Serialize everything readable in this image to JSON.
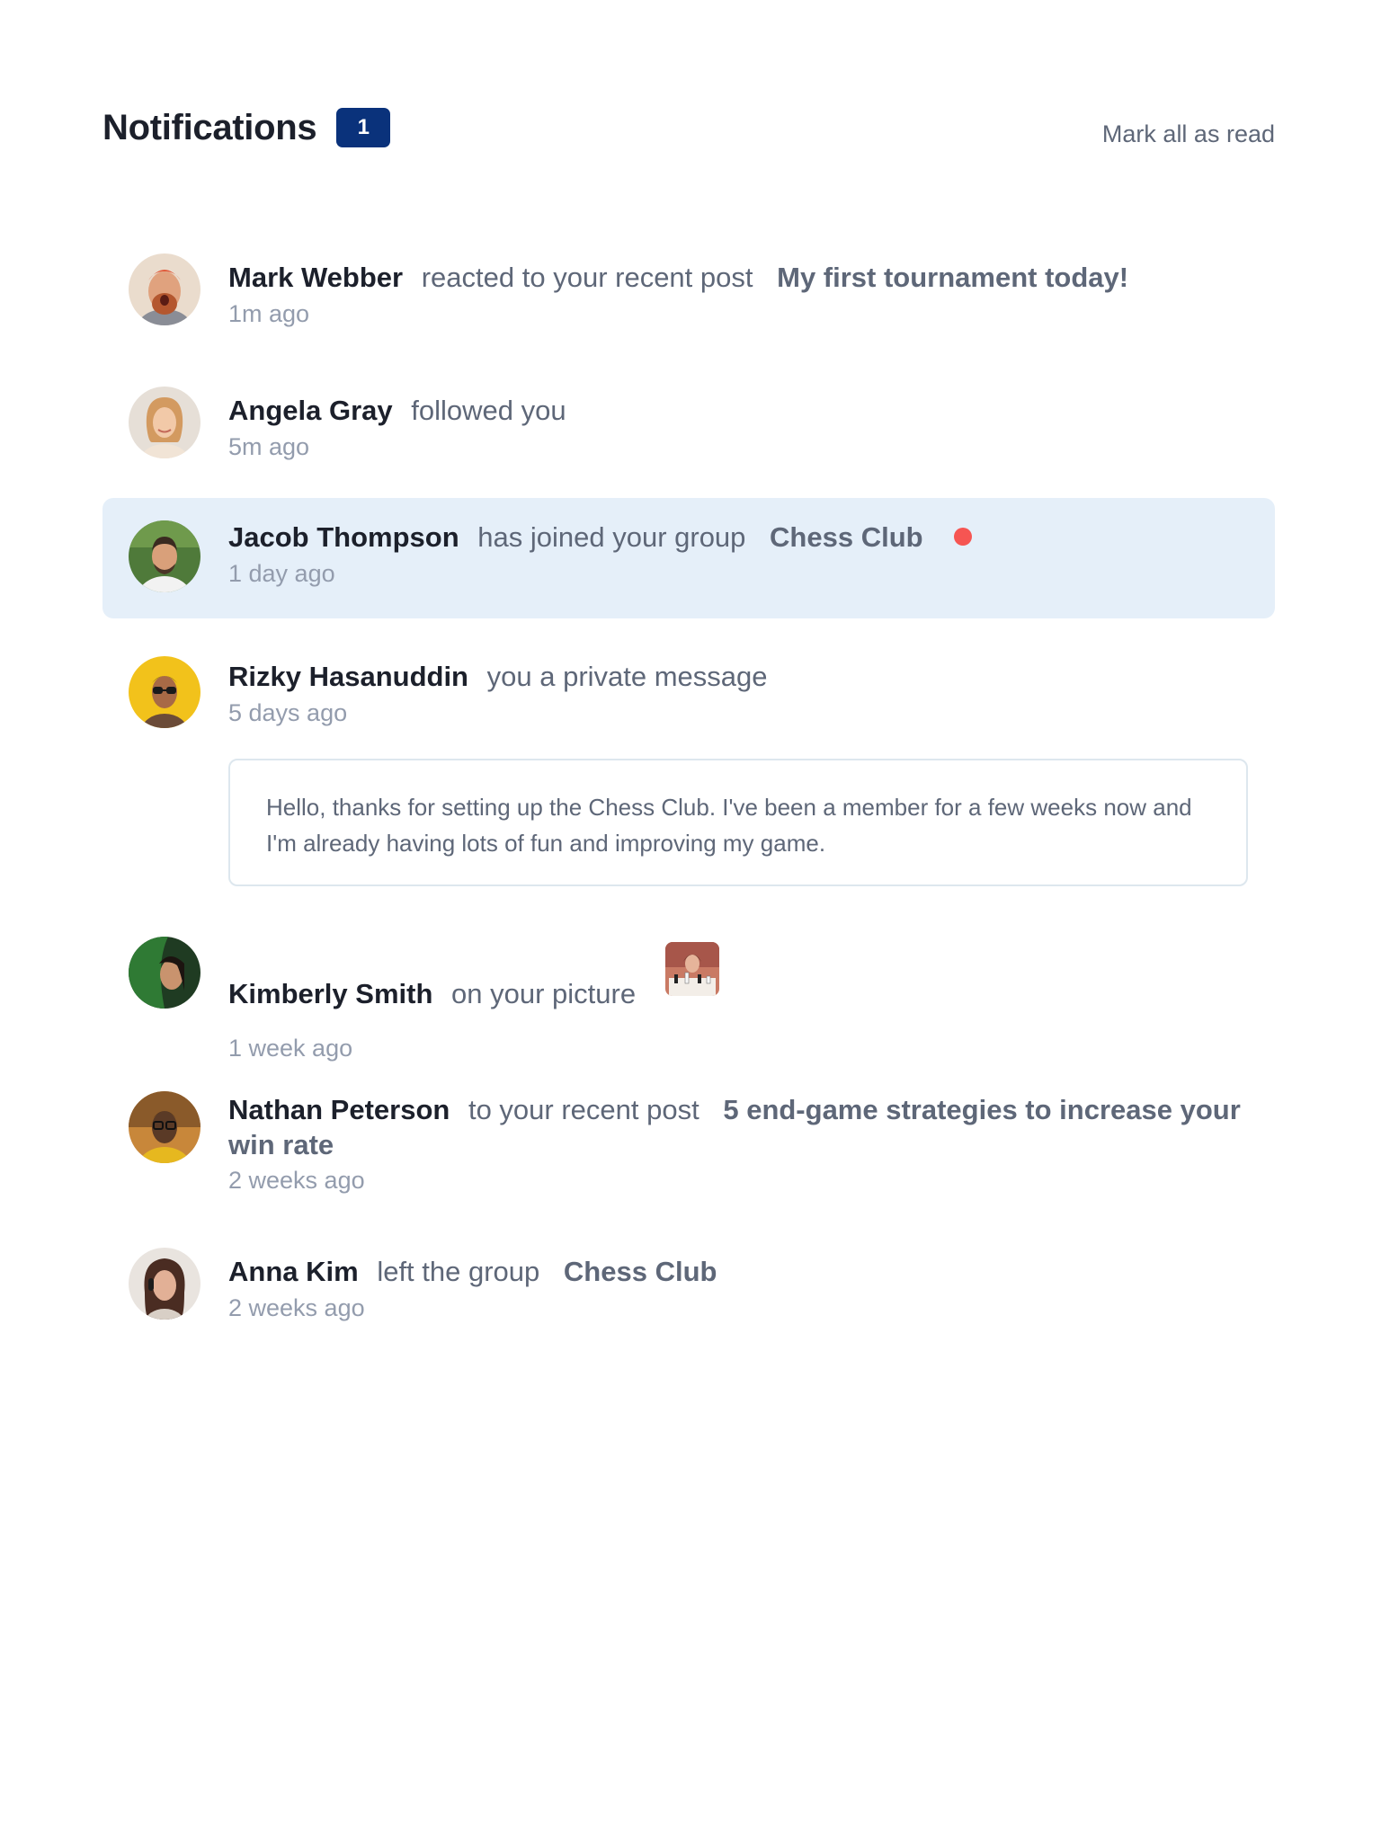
{
  "header": {
    "title": "Notifications",
    "unread_count": "1",
    "mark_all_label": "Mark all as read"
  },
  "notifications": [
    {
      "user": "Mark Webber",
      "action": "reacted to your recent post",
      "target": "My first tournament today!",
      "time": "1m ago",
      "unread": false
    },
    {
      "user": "Angela Gray",
      "action": "followed you",
      "time": "5m ago",
      "unread": false
    },
    {
      "user": "Jacob Thompson",
      "action": "has joined your group",
      "target": "Chess Club",
      "time": "1 day ago",
      "unread": true
    },
    {
      "user": "Rizky Hasanuddin",
      "action": "you a private message",
      "time": "5 days ago",
      "unread": false,
      "message": "Hello, thanks for setting up the Chess Club. I've been a member for a few weeks now and I'm already having lots of fun and improving my game."
    },
    {
      "user": "Kimberly Smith",
      "action": "on your picture",
      "time": "1 week ago",
      "unread": false
    },
    {
      "user": "Nathan Peterson",
      "action": "to your recent post",
      "target": "5 end-game strategies to increase your win rate",
      "time": "2 weeks ago",
      "unread": false
    },
    {
      "user": "Anna Kim",
      "action": "left the group",
      "target": "Chess Club",
      "time": "2 weeks ago",
      "unread": false
    }
  ],
  "colors": {
    "badge": "#0a327b",
    "unread_bg": "#e5eff9",
    "unread_dot": "#f65552",
    "name": "#1c202b",
    "text": "#5e6778",
    "time": "#939cad"
  }
}
